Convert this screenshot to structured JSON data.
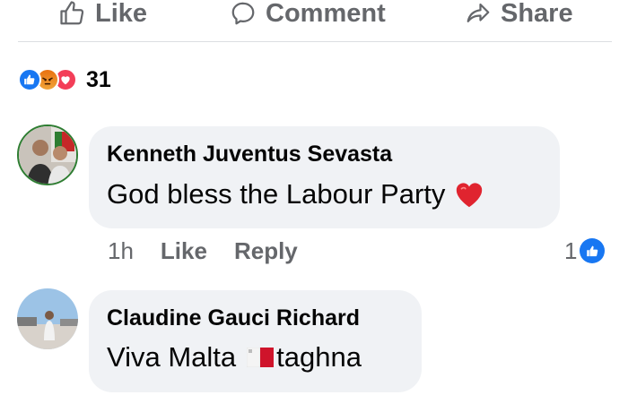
{
  "actions": {
    "like_label": "Like",
    "comment_label": "Comment",
    "share_label": "Share"
  },
  "reactions": {
    "types": [
      "like-icon",
      "angry-icon",
      "love-icon"
    ],
    "count": "31"
  },
  "comments": [
    {
      "author": "Kenneth Juventus Sevasta",
      "text": "God bless the Labour Party",
      "emoji": "❤️",
      "time": "1h",
      "like_label": "Like",
      "reply_label": "Reply",
      "reaction_count": "1"
    },
    {
      "author": "Claudine Gauci Richard",
      "text_before": "Viva Malta",
      "flag": "malta-flag-icon",
      "text_after": "taghna"
    }
  ],
  "colors": {
    "facebook_blue": "#1877f2",
    "bubble_grey": "#f0f2f5",
    "secondary_text": "#65676b",
    "love_red": "#f33e58"
  }
}
